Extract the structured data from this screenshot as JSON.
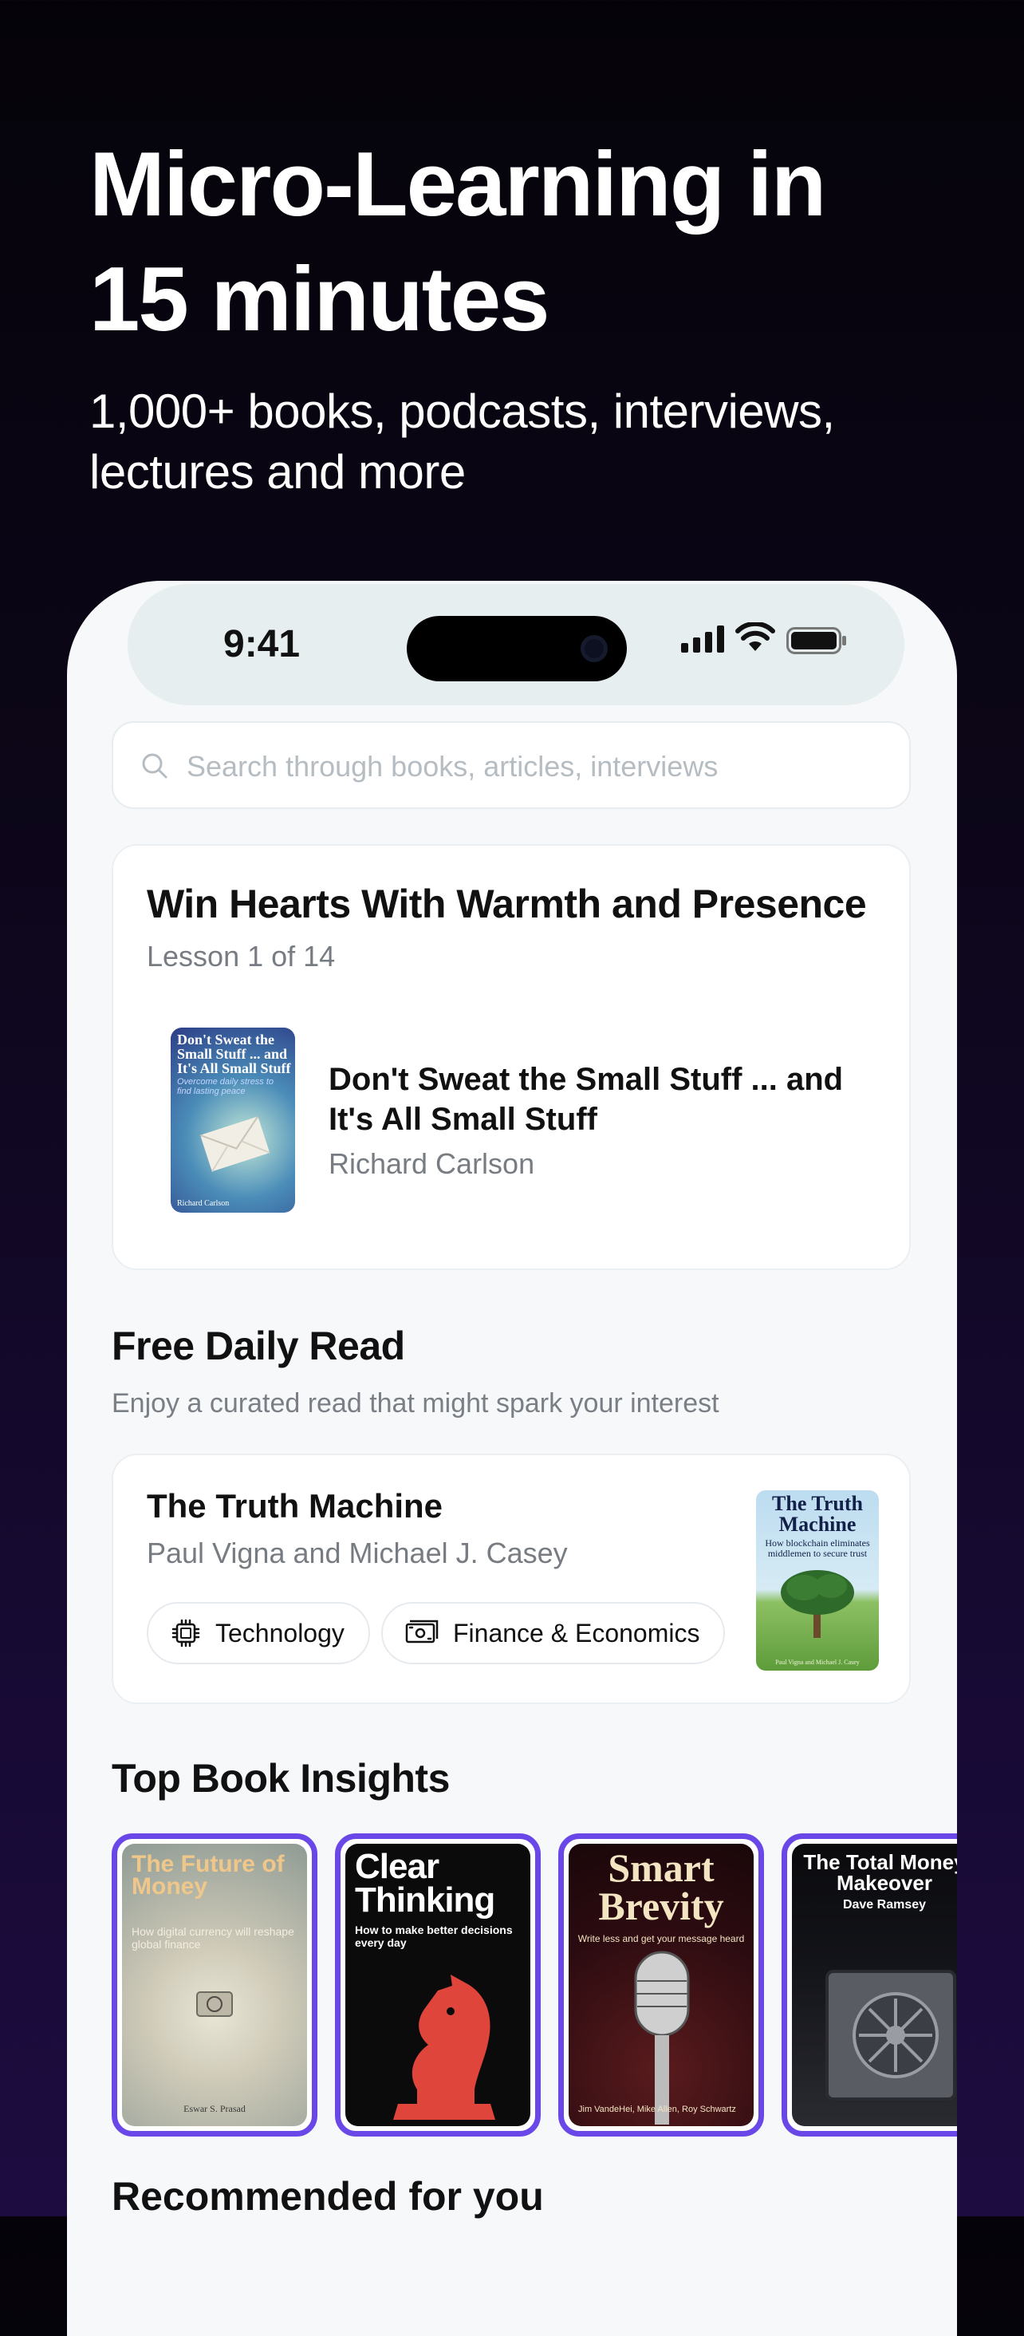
{
  "hero": {
    "title_line1": "Micro-Learning in",
    "title_line2": "15 minutes",
    "subtitle_line1": "1,000+ books, podcasts, interviews,",
    "subtitle_line2": "lectures and more"
  },
  "status_bar": {
    "time": "9:41"
  },
  "search": {
    "placeholder": "Search through books, articles, interviews"
  },
  "lesson_card": {
    "title": "Win Hearts With Warmth and Presence",
    "progress": "Lesson 1 of 14",
    "book_title_line1": "Don't Sweat the Small Stuff ... and",
    "book_title_line2": "It's All Small Stuff",
    "book_author": "Richard Carlson",
    "cover": {
      "title": "Don't Sweat the Small Stuff ... and It's All Small Stuff",
      "subtitle": "Overcome daily stress to find lasting peace",
      "author": "Richard Carlson"
    }
  },
  "daily_read": {
    "heading": "Free Daily Read",
    "description": "Enjoy a curated read that might spark your interest",
    "title": "The Truth Machine",
    "authors": "Paul Vigna and Michael J. Casey",
    "tags": [
      {
        "label": "Technology",
        "icon": "chip-icon"
      },
      {
        "label": "Finance & Economics",
        "icon": "banknote-icon"
      }
    ],
    "cover": {
      "title": "The Truth Machine",
      "subtitle": "How blockchain eliminates middlemen to secure trust",
      "author": "Paul Vigna and Michael J. Casey"
    }
  },
  "top_insights": {
    "heading": "Top Book Insights",
    "accent": "#6a48e8",
    "books": [
      {
        "title": "The Future of Money",
        "subtitle": "How digital currency will reshape global finance",
        "author": "Eswar S. Prasad"
      },
      {
        "title": "Clear Thinking",
        "subtitle": "How to make better decisions every day"
      },
      {
        "title": "Smart Brevity",
        "subtitle": "Write less and get your message heard",
        "author": "Jim VandeHei, Mike Allen, Roy Schwartz"
      },
      {
        "title": "The Total Money Makeover",
        "author": "Dave Ramsey"
      }
    ]
  },
  "recommended": {
    "heading": "Recommended for you"
  }
}
